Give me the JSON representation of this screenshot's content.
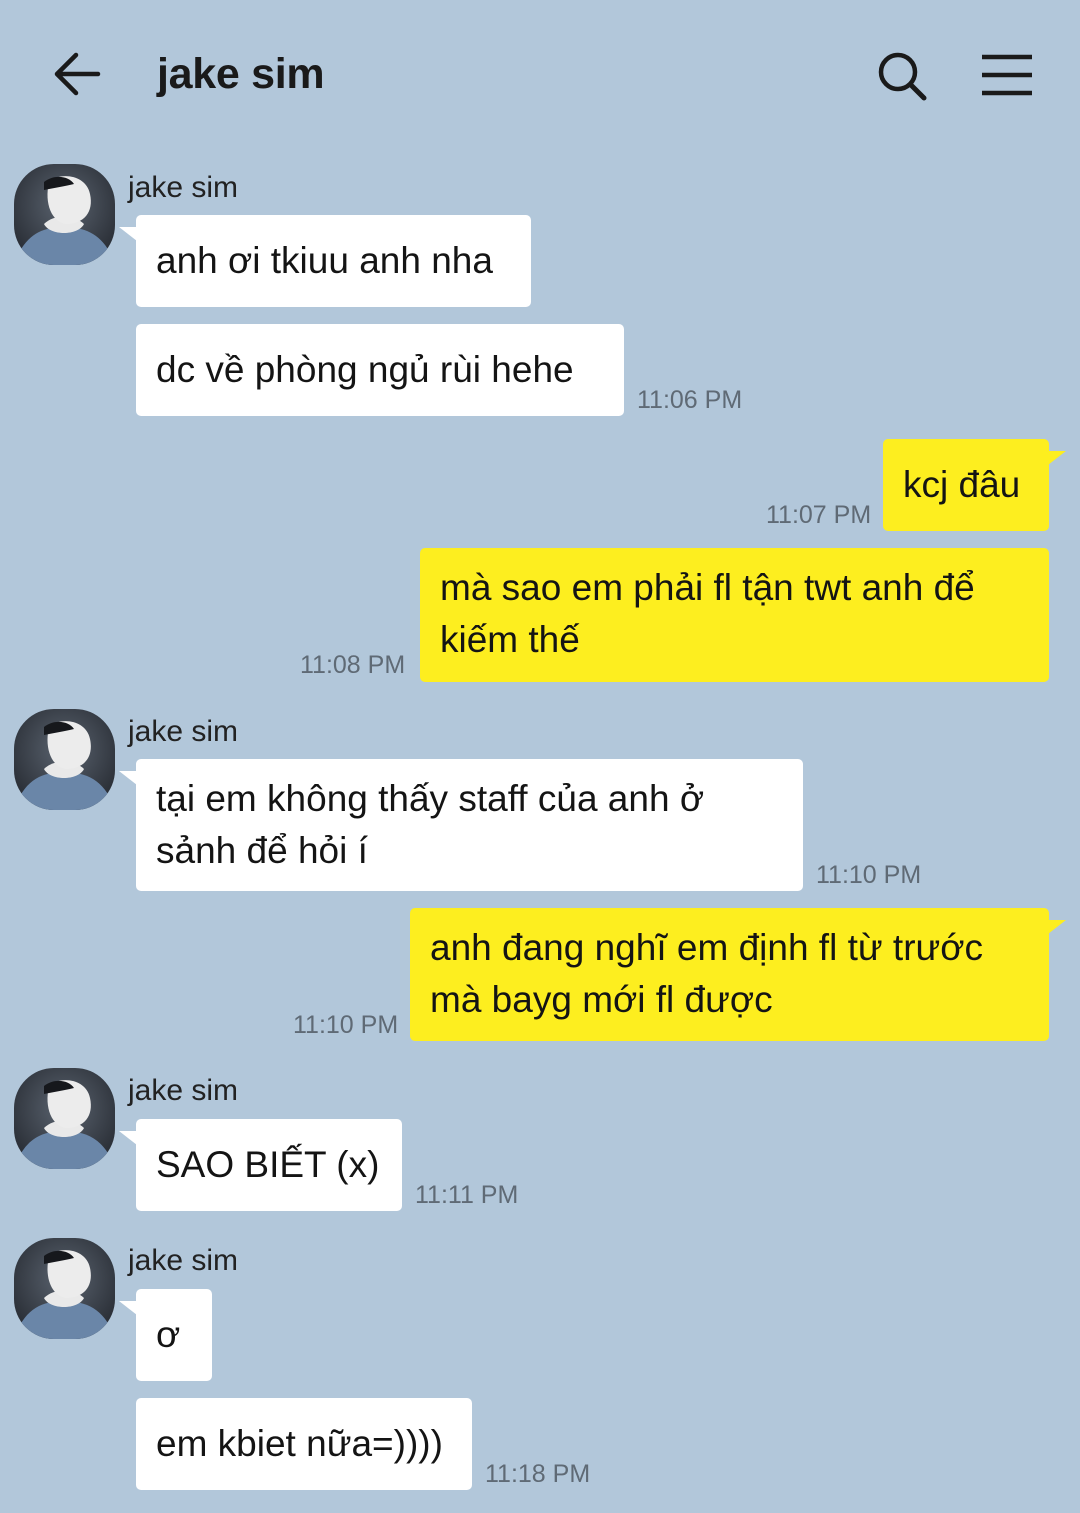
{
  "header": {
    "title": "jake sim",
    "icons": {
      "back": "back-arrow-icon",
      "search": "search-icon",
      "menu": "hamburger-menu-icon"
    }
  },
  "colors": {
    "background": "#b2c7da",
    "incoming_bubble": "#ffffff",
    "outgoing_bubble": "#fdee1f",
    "timestamp": "#5f6a75"
  },
  "messages": [
    {
      "sender": "jake sim",
      "direction": "incoming",
      "text": "anh ơi tkiuu anh nha"
    },
    {
      "direction": "incoming",
      "text": "dc về phòng ngủ rùi hehe",
      "time": "11:06 PM"
    },
    {
      "direction": "outgoing",
      "text": "kcj đâu",
      "time": "11:07 PM"
    },
    {
      "direction": "outgoing",
      "lines": [
        "mà sao em phải fl tận twt anh để",
        "kiếm thế"
      ],
      "time": "11:08 PM"
    },
    {
      "sender": "jake sim",
      "direction": "incoming",
      "lines": [
        "tại em không thấy staff của anh ở",
        "sảnh để hỏi í"
      ],
      "time": "11:10 PM"
    },
    {
      "direction": "outgoing",
      "lines": [
        "anh đang nghĩ em định fl từ trước",
        "mà bayg mới fl được"
      ],
      "time": "11:10 PM"
    },
    {
      "sender": "jake sim",
      "direction": "incoming",
      "text": "SAO BIẾT (x)",
      "time": "11:11 PM"
    },
    {
      "sender": "jake sim",
      "direction": "incoming",
      "text": "ơ"
    },
    {
      "direction": "incoming",
      "text": "em kbiet nữa=))))",
      "time": "11:18 PM"
    }
  ]
}
